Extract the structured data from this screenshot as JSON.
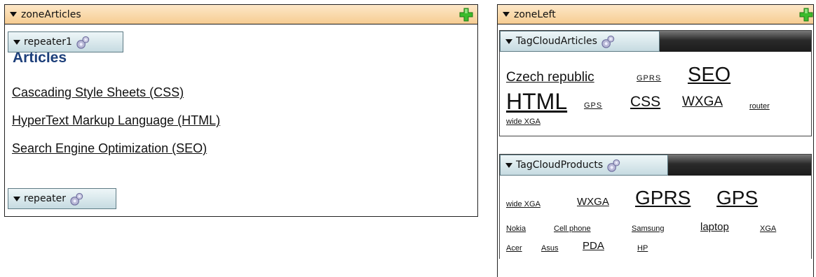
{
  "zone_articles": {
    "title": "zoneArticles",
    "repeater_top_label": "repeater1",
    "heading": "Articles",
    "links": [
      "Cascading Style Sheets (CSS)",
      "HyperText Markup Language (HTML)",
      "Search Engine Optimization (SEO)"
    ],
    "repeater_bottom_label": "repeater"
  },
  "zone_left": {
    "title": "zoneLeft",
    "tagcloud_articles": {
      "label": "TagCloudArticles",
      "tags": [
        "Czech republic",
        "GPRS",
        "SEO",
        "HTML",
        "GPS",
        "CSS",
        "WXGA",
        "router",
        "wide XGA"
      ]
    },
    "tagcloud_products": {
      "label": "TagCloudProducts",
      "tags": [
        "wide XGA",
        "WXGA",
        "GPRS",
        "GPS",
        "Nokia",
        "Cell phone",
        "Samsung",
        "laptop",
        "XGA",
        "Acer",
        "Asus",
        "PDA",
        "HP"
      ]
    }
  },
  "colors": {
    "zone_header": "#f6cc92",
    "widget_bar": "#c6dbe1",
    "heading": "#1d3f7a",
    "plus_icon": "#3dbb2c"
  },
  "icons": [
    "collapse-triangle-icon",
    "add-plus-icon",
    "gear-icon"
  ]
}
